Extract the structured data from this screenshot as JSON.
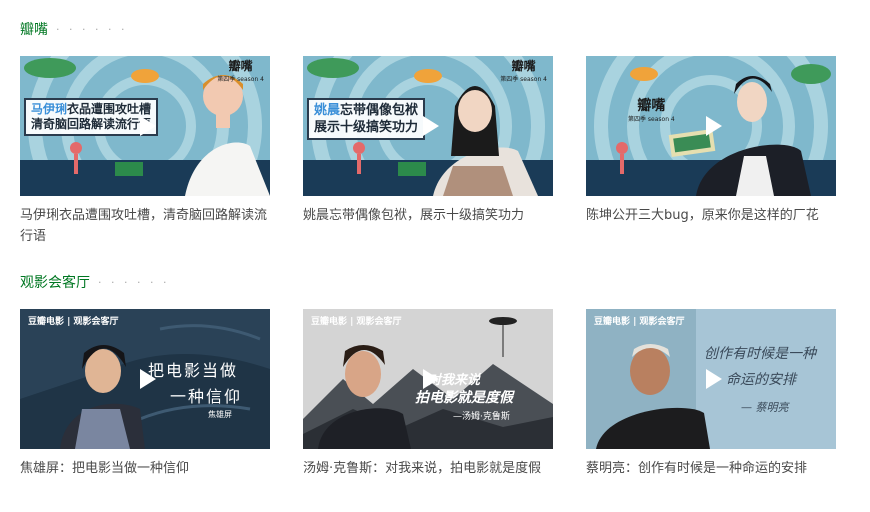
{
  "sections": [
    {
      "title": "瓣嘴",
      "dots": "· · · · · ·",
      "cards": [
        {
          "caption": "马伊琍衣品遭围攻吐槽，清奇脑回路解读流行语",
          "thumb_name": "马伊琍",
          "thumb_rest": "衣品遭围攻吐槽",
          "thumb_line2": "清奇脑回路解读流行语"
        },
        {
          "caption": "姚晨忘带偶像包袱，展示十级搞笑功力",
          "thumb_name": "姚晨",
          "thumb_rest": "忘带偶像包袱",
          "thumb_line2": "展示十级搞笑功力"
        },
        {
          "caption": "陈坤公开三大bug，原来你是这样的厂花"
        }
      ],
      "logo": "瓣嘴",
      "logo_sub": "第四季 season 4"
    },
    {
      "title": "观影会客厅",
      "dots": "· · · · · ·",
      "brand": "豆瓣电影 | 观影会客厅",
      "cards": [
        {
          "caption": "焦雄屏：把电影当做一种信仰",
          "thumb_line1": "把电影当做",
          "thumb_line2": "一种信仰",
          "thumb_sign": "焦雄屏"
        },
        {
          "caption": "汤姆·克鲁斯：对我来说，拍电影就是度假",
          "thumb_line1": "对我来说",
          "thumb_line2": "拍电影就是度假",
          "thumb_sign": "—汤姆·克鲁斯"
        },
        {
          "caption": "蔡明亮：创作有时候是一种命运的安排",
          "thumb_line1": "创作有时候是一种",
          "thumb_line2": "命运的安排",
          "thumb_sign": "— 蔡明亮"
        }
      ]
    }
  ],
  "colors": {
    "section_title": "#007722",
    "caption": "#494949",
    "play": "#ffffff"
  }
}
